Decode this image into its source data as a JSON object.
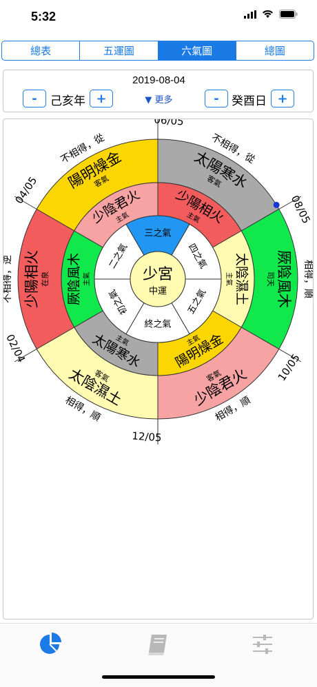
{
  "status": {
    "time": "5:32"
  },
  "tabs": [
    "總表",
    "五運圖",
    "六氣圖",
    "總圖"
  ],
  "active_tab": 2,
  "date": {
    "value": "2019-08-04",
    "year": "己亥年",
    "day": "癸酉日",
    "more": "▼ 更多",
    "minus": "-",
    "plus": "+"
  },
  "wheel": {
    "center_big": "少宮",
    "center_small": "中運",
    "qi_ring": [
      "初之氣",
      "二之氣",
      "三之氣",
      "四之氣",
      "五之氣",
      "終之氣"
    ],
    "main_ring": [
      {
        "name": "厥陰風木",
        "sub": "主氣"
      },
      {
        "name": "少陰君火",
        "sub": "主氣"
      },
      {
        "name": "少陽相火",
        "sub": "主氣"
      },
      {
        "name": "太陰濕土",
        "sub": "主氣"
      },
      {
        "name": "陽明燥金",
        "sub": "主氣"
      },
      {
        "name": "太陽寒水",
        "sub": "主氣"
      }
    ],
    "guest_ring": [
      {
        "name": "陽明燥金",
        "sub": "客氣"
      },
      {
        "name": "太陽寒水",
        "sub": "客氣"
      },
      {
        "name": "厥陰風木",
        "sub": "司天"
      },
      {
        "name": "少陰君火",
        "sub": "客氣"
      },
      {
        "name": "太陰濕土",
        "sub": "客氣"
      },
      {
        "name": "少陽相火",
        "sub": "在泉"
      }
    ],
    "relations": [
      "不相得，從",
      "不相得，從",
      "相得，順",
      "相得，順",
      "相得，順",
      "不相得，逆"
    ],
    "dates": [
      "06/05",
      "08/05",
      "10/05",
      "12/05",
      "02/04",
      "04/05"
    ],
    "colors": {
      "wood": "#11e84c",
      "fire": "#f7a3a3",
      "minister_fire": "#f25c5c",
      "earth": "#fffbb0",
      "metal": "#fcd600",
      "water": "#a9a9a9",
      "highlight": "#2196f3",
      "center": "#fffbb0",
      "marker": "#1a35d6"
    }
  },
  "tabbar": {
    "icons": [
      "pie-chart-icon",
      "book-icon",
      "sliders-icon"
    ],
    "active": 0
  }
}
